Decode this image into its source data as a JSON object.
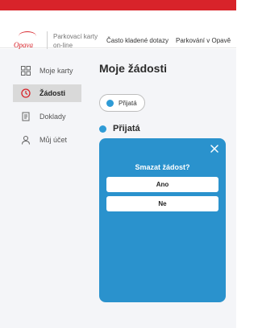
{
  "header": {
    "logo_text": "Opava",
    "app_name": "Parkovací karty on-line",
    "nav_faq": "Často kladené dotazy",
    "nav_opava": "Parkování v Opavě"
  },
  "sidebar": {
    "items": [
      {
        "label": "Moje karty",
        "icon": "grid-icon",
        "active": false
      },
      {
        "label": "Žádosti",
        "icon": "clock-icon",
        "active": true
      },
      {
        "label": "Doklady",
        "icon": "document-icon",
        "active": false
      },
      {
        "label": "Můj účet",
        "icon": "user-icon",
        "active": false
      }
    ]
  },
  "main": {
    "title": "Moje žádosti",
    "filter_chip": "Přijatá",
    "status_label": "Přijatá"
  },
  "dialog": {
    "title": "Smazat žádost?",
    "yes_label": "Ano",
    "no_label": "Ne"
  },
  "colors": {
    "brand_red": "#d8232a",
    "accent_blue": "#2a92cd",
    "status_blue": "#2f9bd6"
  }
}
